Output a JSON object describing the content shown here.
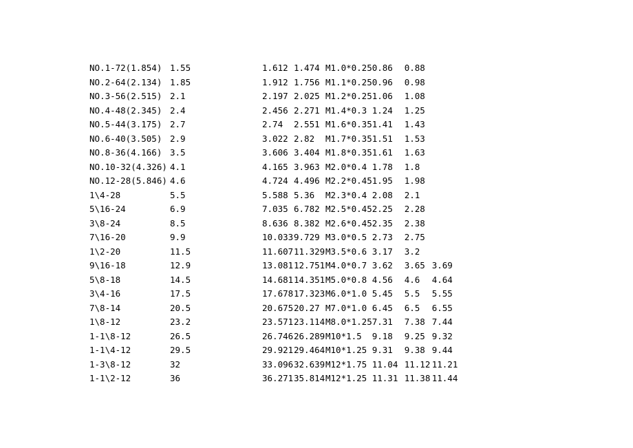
{
  "rows": [
    {
      "c1": "NO.1-72(1.854)",
      "c2": "1.55",
      "c3": "1.612",
      "c4": "1.474",
      "c5": "M1.0*0.25",
      "c6": "0.86",
      "c7": "0.88",
      "c8": ""
    },
    {
      "c1": "NO.2-64(2.134)",
      "c2": "1.85",
      "c3": "1.912",
      "c4": "1.756",
      "c5": "M1.1*0.25",
      "c6": "0.96",
      "c7": "0.98",
      "c8": ""
    },
    {
      "c1": "NO.3-56(2.515)",
      "c2": "2.1",
      "c3": "2.197",
      "c4": "2.025",
      "c5": "M1.2*0.25",
      "c6": "1.06",
      "c7": "1.08",
      "c8": ""
    },
    {
      "c1": "NO.4-48(2.345)",
      "c2": "2.4",
      "c3": "2.456",
      "c4": "2.271",
      "c5": "M1.4*0.3",
      "c6": "1.24",
      "c7": "1.25",
      "c8": ""
    },
    {
      "c1": "NO.5-44(3.175)",
      "c2": "2.7",
      "c3": "2.74",
      "c4": "2.551",
      "c5": "M1.6*0.35",
      "c6": "1.41",
      "c7": "1.43",
      "c8": ""
    },
    {
      "c1": "NO.6-40(3.505)",
      "c2": "2.9",
      "c3": "3.022",
      "c4": "2.82",
      "c5": "M1.7*0.35",
      "c6": "1.51",
      "c7": "1.53",
      "c8": ""
    },
    {
      "c1": "NO.8-36(4.166)",
      "c2": "3.5",
      "c3": "3.606",
      "c4": "3.404",
      "c5": "M1.8*0.35",
      "c6": "1.61",
      "c7": "1.63",
      "c8": ""
    },
    {
      "c1": "NO.10-32(4.326)",
      "c2": "4.1",
      "c3": "4.165",
      "c4": "3.963",
      "c5": "M2.0*0.4",
      "c6": "1.78",
      "c7": "1.8",
      "c8": ""
    },
    {
      "c1": "NO.12-28(5.846)",
      "c2": "4.6",
      "c3": "4.724",
      "c4": "4.496",
      "c5": "M2.2*0.45",
      "c6": "1.95",
      "c7": "1.98",
      "c8": ""
    },
    {
      "c1": "1\\4-28",
      "c2": "5.5",
      "c3": "5.588",
      "c4": "5.36",
      "c5": "M2.3*0.4",
      "c6": "2.08",
      "c7": "2.1",
      "c8": ""
    },
    {
      "c1": "5\\16-24",
      "c2": "6.9",
      "c3": "7.035",
      "c4": "6.782",
      "c5": "M2.5*0.45",
      "c6": "2.25",
      "c7": "2.28",
      "c8": ""
    },
    {
      "c1": "3\\8-24",
      "c2": "8.5",
      "c3": "8.636",
      "c4": "8.382",
      "c5": "M2.6*0.45",
      "c6": "2.35",
      "c7": "2.38",
      "c8": ""
    },
    {
      "c1": "7\\16-20",
      "c2": "9.9",
      "c3": "10.033",
      "c4": "9.729",
      "c5": "M3.0*0.5",
      "c6": "2.73",
      "c7": "2.75",
      "c8": ""
    },
    {
      "c1": "1\\2-20",
      "c2": "11.5",
      "c3": "11.607",
      "c4": "11.329",
      "c5": "M3.5*0.6",
      "c6": "3.17",
      "c7": "3.2",
      "c8": ""
    },
    {
      "c1": "9\\16-18",
      "c2": "12.9",
      "c3": "13.081",
      "c4": "12.751",
      "c5": "M4.0*0.7",
      "c6": "3.62",
      "c7": "3.65",
      "c8": "3.69"
    },
    {
      "c1": "5\\8-18",
      "c2": "14.5",
      "c3": "14.681",
      "c4": "14.351",
      "c5": "M5.0*0.8",
      "c6": "4.56",
      "c7": "4.6",
      "c8": "4.64"
    },
    {
      "c1": "3\\4-16",
      "c2": "17.5",
      "c3": "17.678",
      "c4": "17.323",
      "c5": "M6.0*1.0",
      "c6": "5.45",
      "c7": "5.5",
      "c8": "5.55"
    },
    {
      "c1": "7\\8-14",
      "c2": "20.5",
      "c3": "20.675",
      "c4": "20.27",
      "c5": "M7.0*1.0",
      "c6": "6.45",
      "c7": "6.5",
      "c8": "6.55"
    },
    {
      "c1": "1\\8-12",
      "c2": "23.2",
      "c3": "23.571",
      "c4": "23.114",
      "c5": "M8.0*1.25",
      "c6": "7.31",
      "c7": "7.38",
      "c8": "7.44"
    },
    {
      "c1": "1-1\\8-12",
      "c2": "26.5",
      "c3": "26.746",
      "c4": "26.289",
      "c5": "M10*1.5",
      "c6": "9.18",
      "c7": "9.25",
      "c8": "9.32"
    },
    {
      "c1": "1-1\\4-12",
      "c2": "29.5",
      "c3": "29.921",
      "c4": "29.464",
      "c5": "M10*1.25",
      "c6": "9.31",
      "c7": "9.38",
      "c8": "9.44"
    },
    {
      "c1": "1-3\\8-12",
      "c2": "32",
      "c3": "33.096",
      "c4": "32.639",
      "c5": "M12*1.75",
      "c6": "11.04",
      "c7": "11.12",
      "c8": "11.21"
    },
    {
      "c1": "1-1\\2-12",
      "c2": "36",
      "c3": "36.271",
      "c4": "35.814",
      "c5": "M12*1.25",
      "c6": "11.31",
      "c7": "11.38",
      "c8": "11.44"
    }
  ]
}
